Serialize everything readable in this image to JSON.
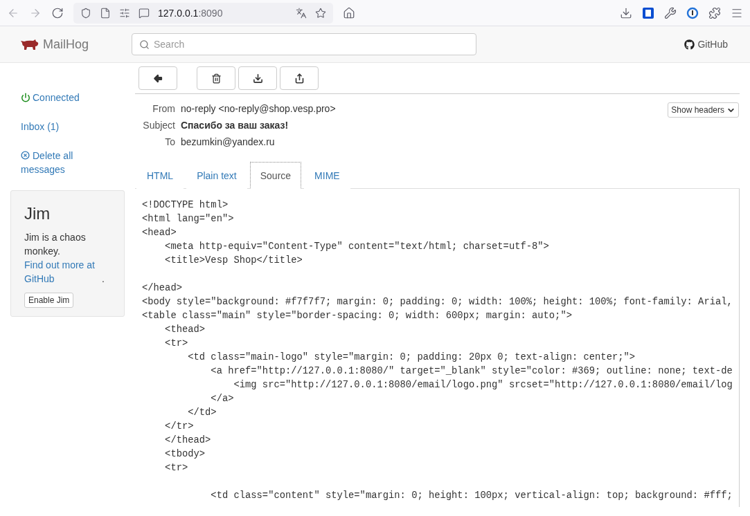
{
  "browser": {
    "url_host": "127.0.0.1",
    "url_port": ":8090"
  },
  "navbar": {
    "brand": "MailHog",
    "search": {
      "placeholder": "Search"
    },
    "github_link": "GitHub"
  },
  "sidebar": {
    "status": "Connected",
    "connected": true,
    "inbox": "Inbox (1)",
    "delete_all": "Delete all messages"
  },
  "jim": {
    "title": "Jim",
    "description": "Jim is a chaos monkey.",
    "link": "Find out more at GitHub",
    "link_end": ".",
    "button": "Enable Jim"
  },
  "toolbar": [
    {
      "kind": "back"
    },
    {
      "kind": "delete"
    },
    {
      "kind": "download"
    },
    {
      "kind": "release"
    }
  ],
  "headers": [
    {
      "label": "From",
      "value": "no-reply <no-reply@shop.vesp.pro>",
      "bold": false
    },
    {
      "label": "Subject",
      "value": "Спасибо за ваш заказ!",
      "bold": true
    },
    {
      "label": "To",
      "value": "bezumkin@yandex.ru",
      "bold": false
    }
  ],
  "show_headers": "Show headers",
  "tabs": [
    {
      "label": "HTML",
      "selected": false
    },
    {
      "label": "Plain text",
      "selected": false
    },
    {
      "label": "Source",
      "selected": true
    },
    {
      "label": "MIME",
      "selected": false
    }
  ],
  "source_blocks": [
    [
      "<!DOCTYPE html>",
      "<html lang=\"en\">",
      "<head>",
      "    <meta http-equiv=\"Content-Type\" content=\"text/html; charset=utf-8\">",
      "    <title>Vesp Shop</title>"
    ],
    [
      "</head>",
      "<body style=\"background: #f7f7f7; margin: 0; padding: 0; width: 100%; height: 100%; font-family: Arial,",
      "<table class=\"main\" style=\"border-spacing: 0; width: 600px; margin: auto;\">",
      "    <thead>",
      "    <tr>",
      "        <td class=\"main-logo\" style=\"margin: 0; padding: 20px 0; text-align: center;\">",
      "            <a href=\"http://127.0.0.1:8080/\" target=\"_blank\" style=\"color: #369; outline: none; text-de",
      "                <img src=\"http://127.0.0.1:8080/email/logo.png\" srcset=\"http://127.0.0.1:8080/email/log",
      "            </a>",
      "        </td>",
      "    </tr>",
      "    </thead>",
      "    <tbody>",
      "    <tr>"
    ],
    [
      "            <td class=\"content\" style=\"margin: 0; height: 100px; vertical-align: top; background: #fff;"
    ]
  ]
}
